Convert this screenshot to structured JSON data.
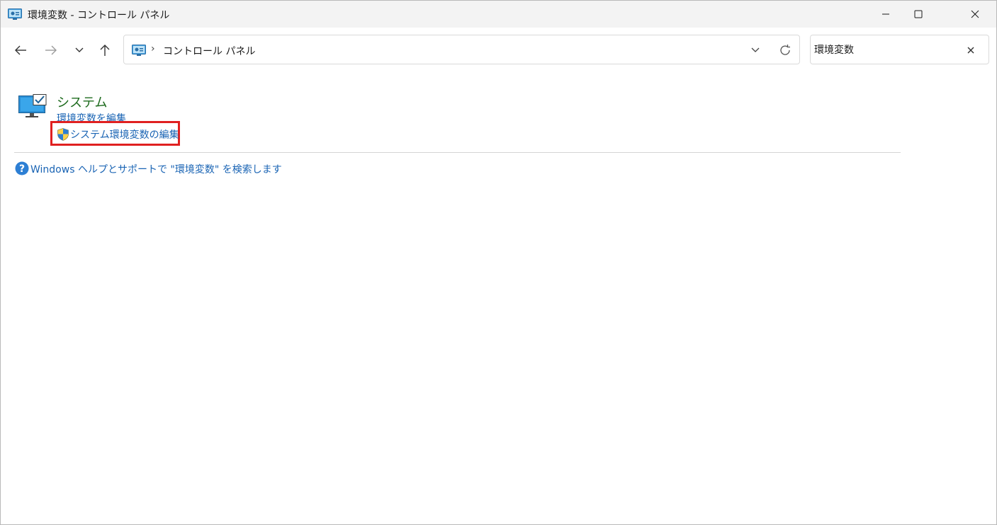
{
  "window": {
    "title": "環境変数 - コントロール パネル"
  },
  "navigation": {
    "breadcrumb_separator": "›",
    "breadcrumb": "コントロール パネル"
  },
  "search": {
    "value": "環境変数"
  },
  "results": {
    "category_title": "システム",
    "link_edit_env": "環境変数を編集",
    "link_edit_system_env": "システム環境変数の編集"
  },
  "help": {
    "link_text": "Windows ヘルプとサポートで \"環境変数\" を検索します"
  },
  "colors": {
    "category_title": "#1e6b1e",
    "link": "#1a64b4",
    "highlight_border": "#e02020",
    "titlebar_bg": "#f3f3f3"
  }
}
